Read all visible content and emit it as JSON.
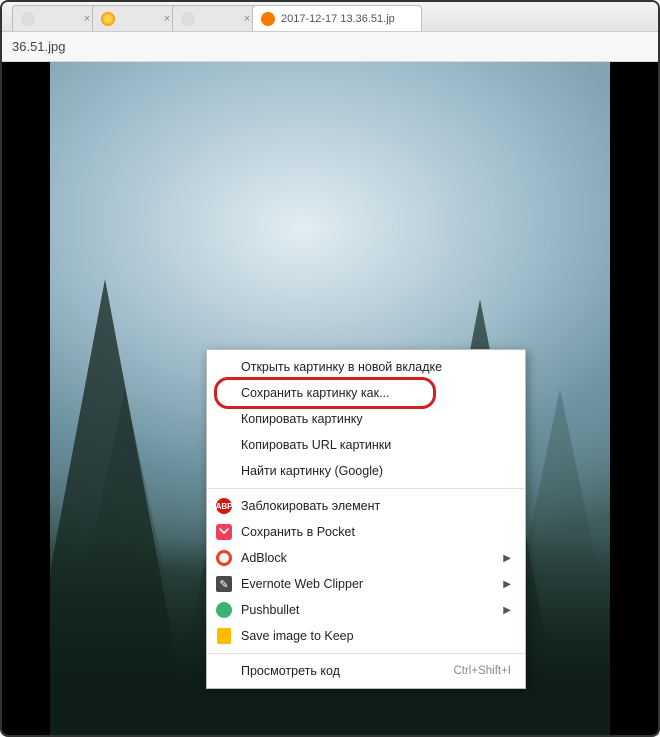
{
  "tabs": {
    "t0": {
      "label": ""
    },
    "t1": {
      "label": ""
    },
    "t2": {
      "label": ""
    },
    "active": {
      "label": "2017-12-17 13.36.51.jp"
    }
  },
  "address": {
    "path": "36.51.jpg"
  },
  "contextMenu": {
    "openNewTab": "Открыть картинку в новой вкладке",
    "saveAs": "Сохранить картинку как...",
    "copyImage": "Копировать картинку",
    "copyUrl": "Копировать URL картинки",
    "findGoogle": "Найти картинку (Google)",
    "blockElement": "Заблокировать элемент",
    "saveToPocket": "Сохранить в Pocket",
    "adblock": "AdBlock",
    "evernote": "Evernote Web Clipper",
    "pushbullet": "Pushbullet",
    "saveToKeep": "Save image to Keep",
    "inspect": "Просмотреть код",
    "inspectShortcut": "Ctrl+Shift+I"
  }
}
